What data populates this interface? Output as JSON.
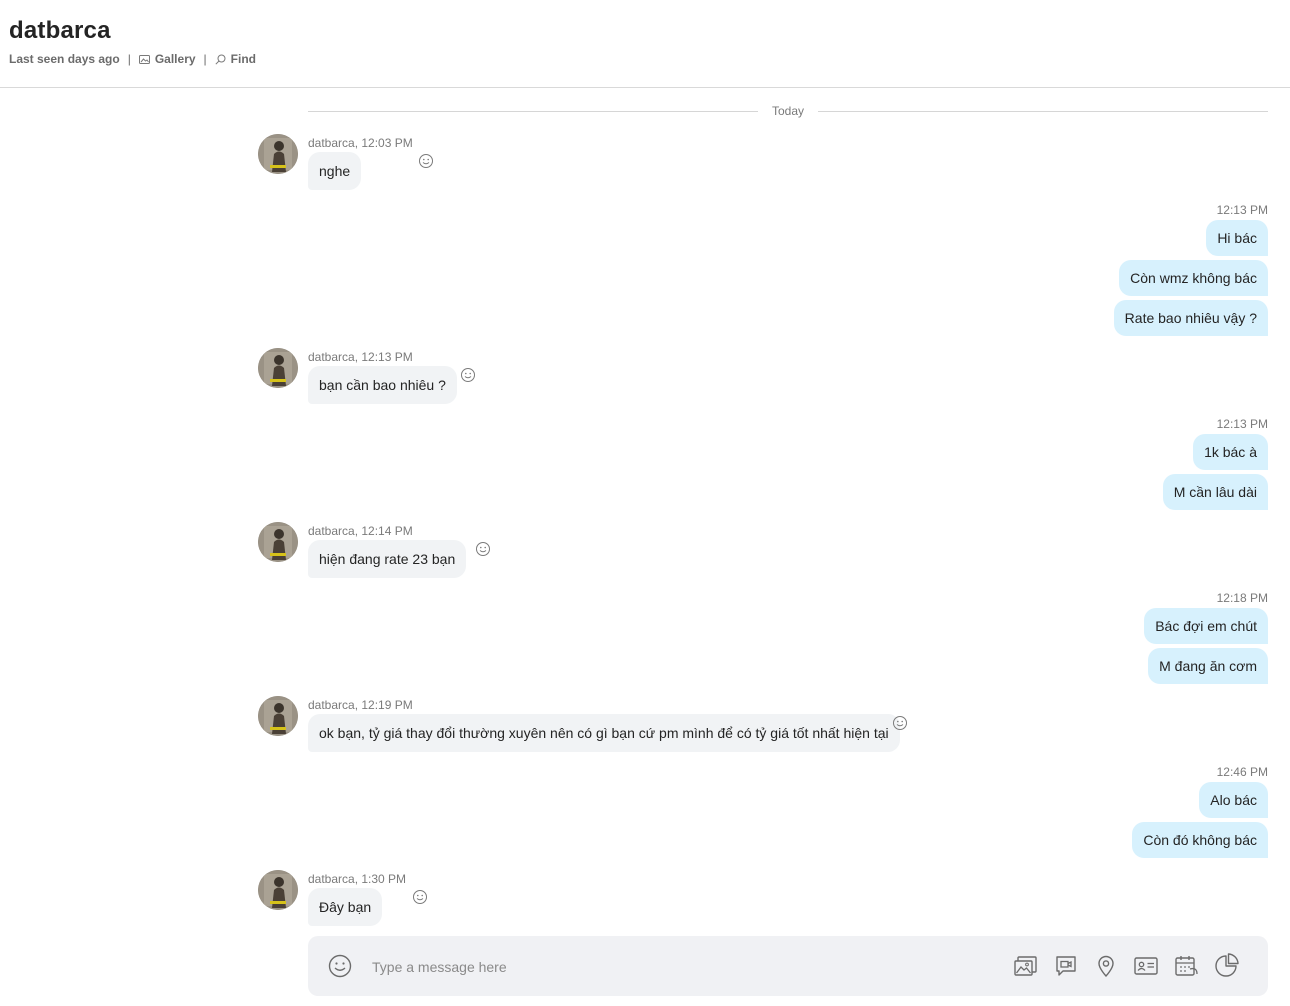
{
  "header": {
    "title": "datbarca",
    "last_seen": "Last seen days ago",
    "separator": "|",
    "gallery_label": "Gallery",
    "find_label": "Find"
  },
  "divider": {
    "label": "Today"
  },
  "messages": [
    {
      "meta": "datbarca, 12:03 PM",
      "text": "nghe"
    },
    {
      "time": "12:13 PM",
      "texts": [
        "Hi bác",
        "Còn wmz không bác",
        "Rate bao nhiêu vậy ?"
      ]
    },
    {
      "meta": "datbarca, 12:13 PM",
      "text": "bạn cần bao nhiêu ?"
    },
    {
      "time": "12:13 PM",
      "texts": [
        "1k bác à",
        "M cần lâu dài"
      ]
    },
    {
      "meta": "datbarca, 12:14 PM",
      "text": "hiện đang rate 23 bạn"
    },
    {
      "time": "12:18 PM",
      "texts": [
        "Bác đợi em chút",
        "M đang ăn cơm"
      ]
    },
    {
      "meta": "datbarca, 12:19 PM",
      "text": "ok bạn, tỷ giá thay đổi thường xuyên nên có gì bạn cứ pm mình để có tỷ giá tốt nhất hiện tại"
    },
    {
      "time": "12:46 PM",
      "texts": [
        "Alo bác",
        "Còn đó không bác"
      ]
    },
    {
      "meta": "datbarca, 1:30 PM",
      "text": "Đây bạn"
    }
  ],
  "composer": {
    "placeholder": "Type a message here"
  },
  "colors": {
    "outgoing_bubble": "#d7f1fd",
    "incoming_bubble": "#f1f3f5",
    "composer_bg": "#f0f1f4"
  },
  "icons": [
    "gallery-icon",
    "search-icon",
    "emoji-icon",
    "image-icon",
    "video-message-icon",
    "location-icon",
    "contact-card-icon",
    "call-schedule-icon",
    "poll-icon"
  ]
}
